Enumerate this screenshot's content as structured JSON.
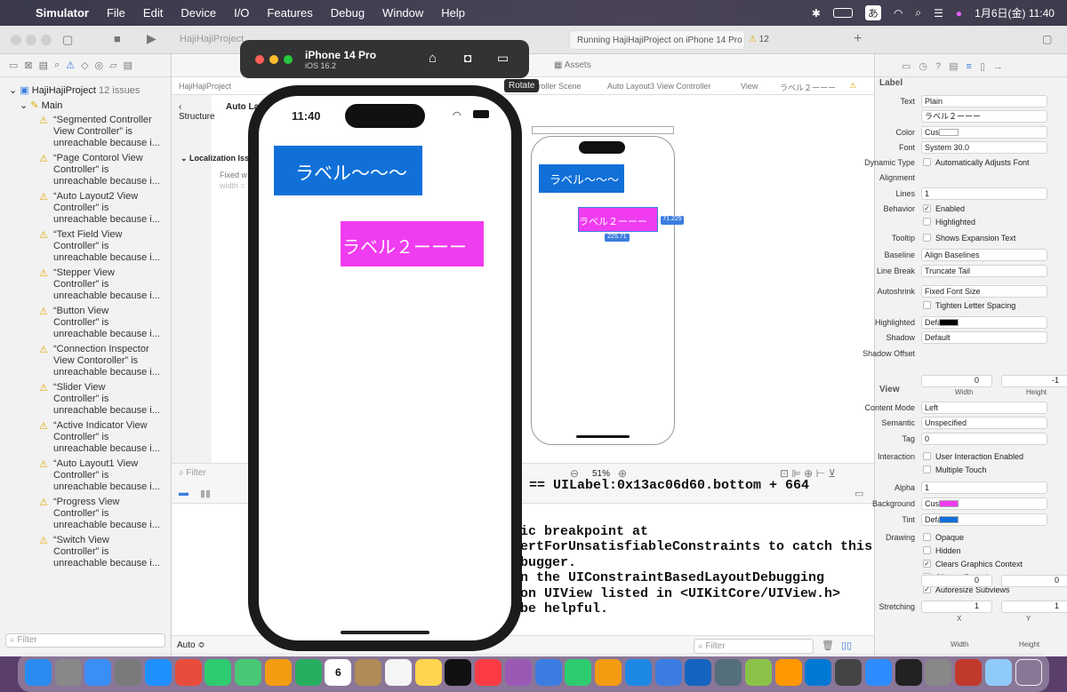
{
  "menubar": {
    "app": "Simulator",
    "items": [
      "File",
      "Edit",
      "Device",
      "I/O",
      "Features",
      "Debug",
      "Window",
      "Help"
    ],
    "clock": "1月6日(金)  11:40",
    "input_method": "あ"
  },
  "toolbar": {
    "project": "HajiHajiProject",
    "status": "Running HajiHajiProject on iPhone 14 Pro",
    "issue_count": "12",
    "assets": "Assets",
    "rotate_tooltip": "Rotate"
  },
  "breadcrumb": [
    "HajiHajiProject",
    "Auto Layout3 View Controller",
    "View",
    "ラベル２ーーー"
  ],
  "navigator": {
    "root": "HajiHajiProject",
    "root_issues": "12 issues",
    "group": "Main",
    "issues": [
      [
        "“Segmented Controller",
        "View Controller” is",
        "unreachable because i..."
      ],
      [
        "“Page Contorol View",
        "Controller” is",
        "unreachable because i..."
      ],
      [
        "“Auto Layout2 View",
        "Controller” is",
        "unreachable because i..."
      ],
      [
        "“Text Field View",
        "Controller” is",
        "unreachable because i..."
      ],
      [
        "“Stepper View",
        "Controller” is",
        "unreachable because i..."
      ],
      [
        "“Button View",
        "Controller” is",
        "unreachable because i..."
      ],
      [
        "“Connection Inspector",
        "View Contoroller” is",
        "unreachable because i..."
      ],
      [
        "“Slider View",
        "Controller” is",
        "unreachable because i..."
      ],
      [
        "“Active Indicator View",
        "Controller” is",
        "unreachable because i..."
      ],
      [
        "“Auto Layout1 View",
        "Controller” is",
        "unreachable because i..."
      ],
      [
        "“Progress View",
        "Controller” is",
        "unreachable because i..."
      ],
      [
        "“Switch View",
        "Controller” is",
        "unreachable because i..."
      ]
    ],
    "filter_placeholder": "Filter"
  },
  "editor": {
    "structure": "Structure",
    "auto_lay": "Auto Lay",
    "localization": "Localization Iss",
    "fixed": "Fixed w",
    "width": "width =",
    "zoom": "51%",
    "filter_placeholder": "Filter",
    "auto": "Auto ≎",
    "scene": "troller Scene",
    "canvas_label1": "ラベル〜〜〜",
    "canvas_label2": "ラベル２ーーー",
    "dim1": "71.225",
    "dim2": "225.71"
  },
  "console": [
    "== UILabel:0x13ac06d60.bottom + 664",
    "",
    "ic breakpoint at",
    "ertForUnsatisfiableConstraints to catch this",
    "bugger.",
    "n the UIConstraintBasedLayoutDebugging",
    "on UIView listed in <UIKitCore/UIView.h>",
    "be helpful."
  ],
  "simulator": {
    "device": "iPhone 14 Pro",
    "os": "iOS 16.2",
    "time": "11:40",
    "label1": "ラベル〜〜〜",
    "label2": "ラベル２ーーー",
    "label1_color": "#1170d8",
    "label2_color": "#f03cf0"
  },
  "inspector": {
    "label_header": "Label",
    "rows": [
      [
        "Text",
        "Plain"
      ],
      [
        "",
        "ラベル２ーーー"
      ],
      [
        "Color",
        "Custom"
      ],
      [
        "Font",
        "System 30.0"
      ],
      [
        "Dynamic Type",
        "Automatically Adjusts Font"
      ],
      [
        "Alignment",
        ""
      ],
      [
        "Lines",
        "1"
      ],
      [
        "Behavior",
        "Enabled"
      ],
      [
        "",
        "Highlighted"
      ],
      [
        "Tooltip",
        "Shows Expansion Text"
      ],
      [
        "Baseline",
        "Align Baselines"
      ],
      [
        "Line Break",
        "Truncate Tail"
      ],
      [
        "Autoshrink",
        "Fixed Font Size"
      ],
      [
        "",
        "Tighten Letter Spacing"
      ],
      [
        "Highlighted",
        "Default"
      ],
      [
        "Shadow",
        "Default"
      ],
      [
        "Shadow Offset",
        ""
      ]
    ],
    "shadow_w": "0",
    "shadow_h": "-1",
    "width": "Width",
    "height": "Height",
    "view_header": "View",
    "view_rows": [
      [
        "Content Mode",
        "Left"
      ],
      [
        "Semantic",
        "Unspecified"
      ],
      [
        "Tag",
        "0"
      ],
      [
        "Interaction",
        "User Interaction Enabled"
      ],
      [
        "",
        "Multiple Touch"
      ],
      [
        "Alpha",
        "1"
      ],
      [
        "Background",
        "Custom"
      ],
      [
        "Tint",
        "Default"
      ],
      [
        "Drawing",
        "Opaque"
      ],
      [
        "",
        "Hidden"
      ],
      [
        "",
        "Clears Graphics Context"
      ],
      [
        "",
        "Clips to Bounds"
      ],
      [
        "",
        "Autoresize Subviews"
      ],
      [
        "Stretching",
        ""
      ]
    ],
    "stretch_x": "0",
    "stretch_y": "0",
    "stretch_w": "1",
    "stretch_h": "1",
    "x": "X",
    "y": "Y",
    "filter_placeholder": "Filter"
  },
  "dock": [
    "Finder",
    "Launchpad",
    "Mail",
    "Settings",
    "Safari",
    "Chrome",
    "Messages",
    "Maps",
    "Photos",
    "FaceTime",
    "Calendar",
    "Notes",
    "Reminders",
    "Notes2",
    "TV",
    "Music",
    "Podcasts",
    "Keynote",
    "Numbers",
    "Pages",
    "App Store",
    "Store2",
    "Xcode",
    "Tools",
    "Tools2",
    "Books",
    "VS Code",
    "Simulator",
    "Zoom",
    "Terminal",
    "Dictionary",
    "Kana",
    "Preview",
    "Trash"
  ],
  "calendar_day": "6"
}
